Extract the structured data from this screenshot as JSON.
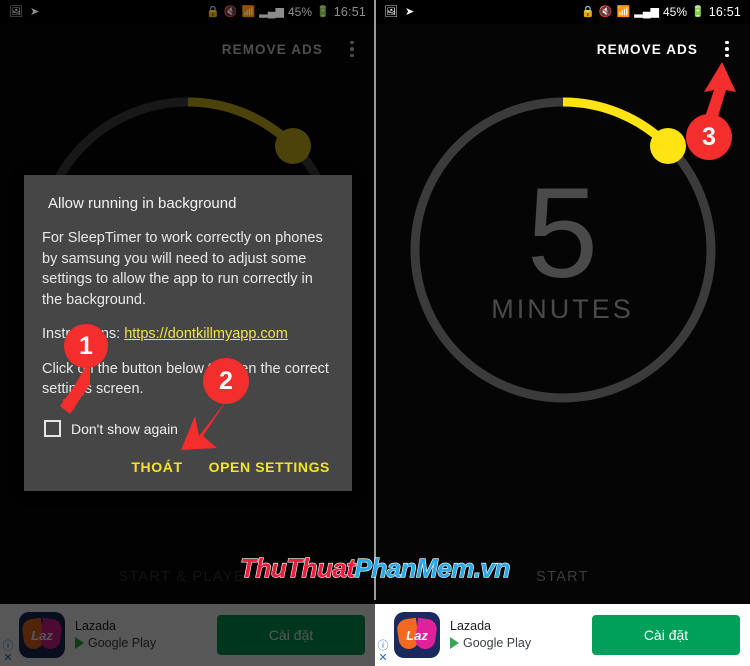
{
  "status_bar": {
    "left_icons": [
      "image-icon",
      "send-icon"
    ],
    "right_icons": [
      "battery-saver-icon",
      "mute-icon",
      "wifi-icon",
      "signal-icon"
    ],
    "battery_percent": "45%",
    "battery_icon": "battery-icon",
    "time": "16:51"
  },
  "app_bar": {
    "remove_ads_label": "REMOVE ADS",
    "overflow_icon": "kebab-menu-icon"
  },
  "timer": {
    "value": "5",
    "unit": "MINUTES",
    "arc_color": "#ffe312",
    "track_color": "#3b3b3b",
    "progress_fraction": 0.11
  },
  "bottom_bar": {
    "left_label": "START & PLAYER",
    "right_label": "START"
  },
  "dialog": {
    "title": "Allow running in background",
    "body": "For SleepTimer to work correctly on phones by samsung you will need to adjust some settings to allow the app to run correctly in the background.",
    "instructions_label": "Instructions:",
    "instructions_link": "https://dontkillmyapp.com",
    "body2": "Click on the button below to open the correct settings screen.",
    "checkbox_label": "Don't show again",
    "checkbox_checked": false,
    "cancel_label": "THOÁT",
    "confirm_label": "OPEN SETTINGS",
    "accent_color": "#f5e425",
    "background_color": "#464646"
  },
  "ad": {
    "app_name": "Lazada",
    "store_name": "Google Play",
    "icon_text": "Laz",
    "cta_label": "Cài đặt",
    "cta_color": "#00a05a",
    "info_icon": "info-icon",
    "close_icon": "close-icon"
  },
  "annotations": [
    {
      "number": "1",
      "target": "dont-show-again-checkbox"
    },
    {
      "number": "2",
      "target": "cancel-button"
    },
    {
      "number": "3",
      "target": "overflow-menu-button"
    }
  ],
  "watermark": {
    "part1": "ThuThuat",
    "part2": "PhanMem",
    "part3": ".vn"
  }
}
